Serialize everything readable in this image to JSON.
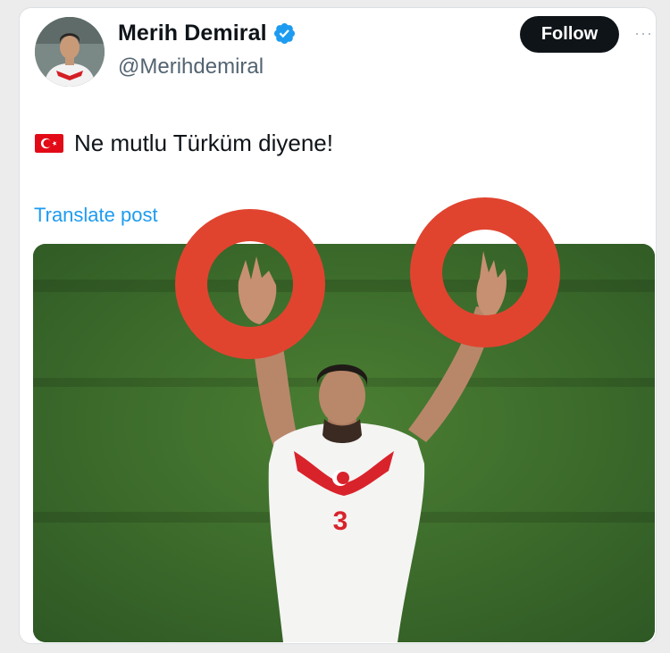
{
  "author": {
    "display_name": "Merih Demiral",
    "handle": "@Merihdemiral",
    "verified": true,
    "verified_color": "#1d9bf0"
  },
  "actions": {
    "follow_label": "Follow",
    "more_label": "···"
  },
  "post": {
    "flag_icon": "turkey-flag-icon",
    "text": "Ne mutlu Türküm diyene!",
    "translate_label": "Translate post"
  },
  "colors": {
    "accent": "#1d9bf0",
    "text": "#0f1419",
    "secondary": "#536471",
    "button_bg": "#0f1419",
    "highlight_ring": "#e0442f",
    "pitch_green": "#3b6b2c",
    "flag_red": "#e30a17"
  },
  "media": {
    "jersey_number": "3"
  }
}
